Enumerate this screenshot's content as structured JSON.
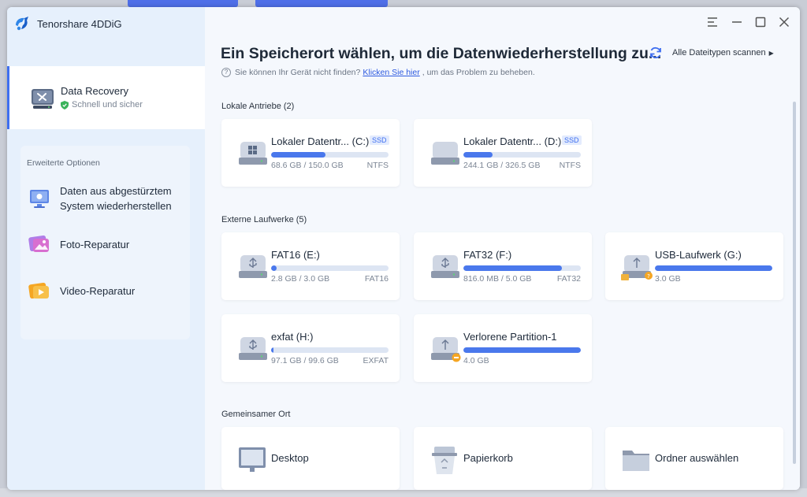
{
  "app": {
    "title": "Tenorshare 4DDiG"
  },
  "sidebar": {
    "active": {
      "title": "Data Recovery",
      "subtitle": "Schnell und sicher"
    },
    "advanced_title": "Erweiterte Optionen",
    "advanced_items": [
      {
        "label_line1": "Daten aus abgestürztem",
        "label_line2": "System wiederherstellen",
        "icon": "crashed-system-icon"
      },
      {
        "label": "Foto-Reparatur",
        "icon": "photo-repair-icon"
      },
      {
        "label": "Video-Reparatur",
        "icon": "video-repair-icon"
      }
    ]
  },
  "main": {
    "headline": "Ein Speicherort wählen, um die Datenwiederherstellung zu...",
    "scan_all": "Alle Dateitypen scannen",
    "help": {
      "prefix": "Sie können Ihr Gerät nicht finden?",
      "link": "Klicken Sie hier",
      "suffix": ", um das Problem zu beheben."
    },
    "local_label": "Lokale Antriebe (2)",
    "local_drives": [
      {
        "name": "Lokaler Datentr... (C:)",
        "badge": "SSD",
        "size": "68.6 GB / 150.0 GB",
        "fs": "NTFS",
        "used": 0.46
      },
      {
        "name": "Lokaler Datentr... (D:)",
        "badge": "SSD",
        "size": "244.1 GB / 326.5 GB",
        "fs": "NTFS",
        "used": 0.25
      }
    ],
    "external_label": "Externe Laufwerke (5)",
    "external_drives": [
      {
        "name": "FAT16 (E:)",
        "size": "2.8 GB / 3.0 GB",
        "fs": "FAT16",
        "used": 0.05
      },
      {
        "name": "FAT32 (F:)",
        "size": "816.0 MB / 5.0 GB",
        "fs": "FAT32",
        "used": 0.84
      },
      {
        "name": "USB-Laufwerk (G:)",
        "size": "3.0 GB",
        "fs": "",
        "used": 1.0
      },
      {
        "name": "exfat (H:)",
        "size": "97.1 GB / 99.6 GB",
        "fs": "EXFAT",
        "used": 0.02
      },
      {
        "name": "Verlorene Partition-1",
        "size": "4.0 GB",
        "fs": "",
        "used": 1.0
      }
    ],
    "shared_label": "Gemeinsamer Ort",
    "shared_locations": [
      {
        "name": "Desktop"
      },
      {
        "name": "Papierkorb"
      },
      {
        "name": "Ordner auswählen"
      }
    ]
  },
  "colors": {
    "accent": "#3f6ff0",
    "bar_fill": "#4a78ec",
    "warning": "#f5a623"
  }
}
